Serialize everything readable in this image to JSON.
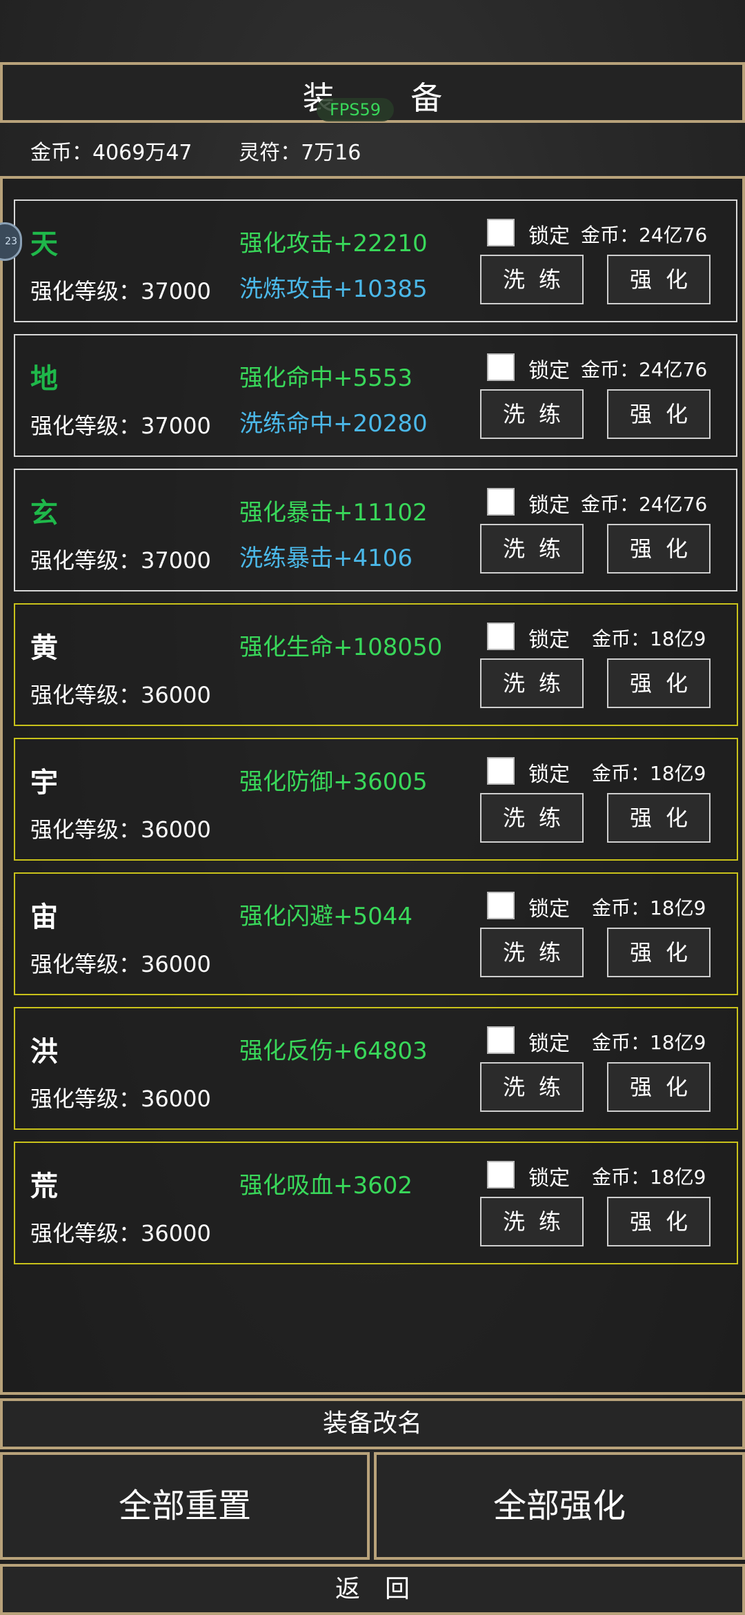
{
  "header": {
    "title": "装 备",
    "fps": "FPS59"
  },
  "currency": {
    "gold": "金币：4069万47",
    "talisman": "灵符：7万16"
  },
  "side_avatar": {
    "label": "23"
  },
  "items": [
    {
      "name": "天",
      "level": "强化等级：37000",
      "stat_enhance": "强化攻击+22210",
      "stat_refine": "洗炼攻击+10385",
      "lock": "锁定",
      "cost": "金币：24亿76",
      "wash": "洗练",
      "enhance": "强化"
    },
    {
      "name": "地",
      "level": "强化等级：37000",
      "stat_enhance": "强化命中+5553",
      "stat_refine": "洗练命中+20280",
      "lock": "锁定",
      "cost": "金币：24亿76",
      "wash": "洗练",
      "enhance": "强化"
    },
    {
      "name": "玄",
      "level": "强化等级：37000",
      "stat_enhance": "强化暴击+11102",
      "stat_refine": "洗练暴击+4106",
      "lock": "锁定",
      "cost": "金币：24亿76",
      "wash": "洗练",
      "enhance": "强化"
    },
    {
      "name": "黄",
      "level": "强化等级：36000",
      "stat_enhance": "强化生命+108050",
      "lock": "锁定",
      "cost": "金币：18亿9",
      "wash": "洗练",
      "enhance": "强化"
    },
    {
      "name": "宇",
      "level": "强化等级：36000",
      "stat_enhance": "强化防御+36005",
      "lock": "锁定",
      "cost": "金币：18亿9",
      "wash": "洗练",
      "enhance": "强化"
    },
    {
      "name": "宙",
      "level": "强化等级：36000",
      "stat_enhance": "强化闪避+5044",
      "lock": "锁定",
      "cost": "金币：18亿9",
      "wash": "洗练",
      "enhance": "强化"
    },
    {
      "name": "洪",
      "level": "强化等级：36000",
      "stat_enhance": "强化反伤+64803",
      "lock": "锁定",
      "cost": "金币：18亿9",
      "wash": "洗练",
      "enhance": "强化"
    },
    {
      "name": "荒",
      "level": "强化等级：36000",
      "stat_enhance": "强化吸血+3602",
      "lock": "锁定",
      "cost": "金币：18亿9",
      "wash": "洗练",
      "enhance": "强化"
    }
  ],
  "footer": {
    "rename": "装备改名",
    "reset_all": "全部重置",
    "enhance_all": "全部强化",
    "back": "返回"
  },
  "colors": {
    "frame": "#b8a27a",
    "tier1_border": "#d8d8d8",
    "tier2_border": "#c9c21a",
    "stat_green": "#39d85a",
    "stat_blue": "#4bb8e8",
    "name_green": "#1fb84a"
  }
}
